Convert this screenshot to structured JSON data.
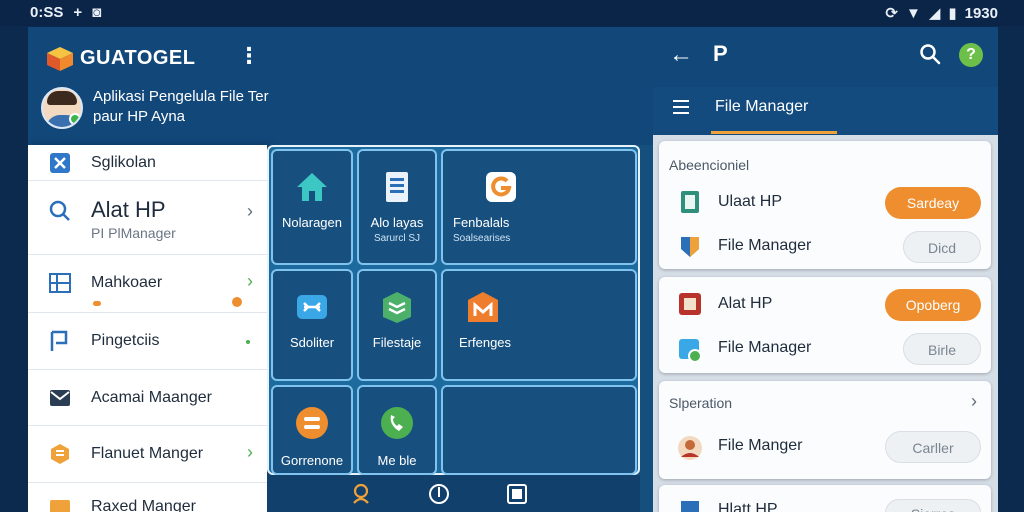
{
  "status_bar": {
    "time": "0:SS",
    "right_text": "1930"
  },
  "header": {
    "app_name": "GUATOGEL",
    "subtitle": "Aplikasi Pengelula File Ter paur HP Ayna"
  },
  "appbar": {
    "back_glyph": "←",
    "pin_glyph": "P",
    "help_glyph": "?",
    "toolbar_title": "File Manager"
  },
  "drawer": {
    "items": [
      {
        "label": "Sglikolan",
        "icon": "x-app-icon"
      },
      {
        "label": "Alat HP",
        "sub": "PI PlManager",
        "icon": "search-icon"
      },
      {
        "label": "Mahkoaer",
        "icon": "grid-icon"
      },
      {
        "label": "Pingetciis",
        "icon": "flag-icon"
      },
      {
        "label": "Acamai Maanger",
        "icon": "mail-icon"
      },
      {
        "label": "Flanuet Manger",
        "icon": "hexagon-icon"
      },
      {
        "label": "Raxed Manger",
        "icon": "folder-icon"
      }
    ]
  },
  "grid": {
    "tiles": [
      {
        "label": "Nolaragen",
        "icon": "home-icon"
      },
      {
        "label": "Alo layas",
        "sub": "Sarurcl SJ",
        "icon": "document-icon"
      },
      {
        "label": "Fenbalals",
        "sub": "Soalsearises",
        "icon": "g-app-icon"
      },
      {
        "label": "Sdoliter",
        "icon": "link-icon"
      },
      {
        "label": "Filestaje",
        "icon": "layers-icon"
      },
      {
        "label": "Erfenges",
        "icon": "m-app-icon"
      },
      {
        "label": "Gorrenone",
        "icon": "chat-icon"
      },
      {
        "label": "Me ble",
        "icon": "phone-icon"
      }
    ]
  },
  "right": {
    "card1": {
      "title": "Abeencioniel",
      "rows": [
        {
          "label": "Ulaat HP",
          "button": "Sardeay",
          "style": "orange"
        },
        {
          "label": "File Manager",
          "button": "Dicd",
          "style": "grey"
        }
      ]
    },
    "card2": {
      "rows": [
        {
          "label": "Alat HP",
          "button": "Opoberg",
          "style": "orange"
        },
        {
          "label": "File Manager",
          "button": "Birle",
          "style": "grey"
        }
      ]
    },
    "card3": {
      "title": "Slperation",
      "rows": [
        {
          "label": "File Manger",
          "button": "Carller",
          "style": "grey"
        }
      ]
    },
    "card4": {
      "rows": [
        {
          "label": "Hlatt HP",
          "button": "Sierres",
          "style": "grey"
        }
      ]
    }
  },
  "colors": {
    "accent_orange": "#ef8e2e",
    "primary_blue": "#12477a",
    "tile_border": "#7fc3ee"
  }
}
